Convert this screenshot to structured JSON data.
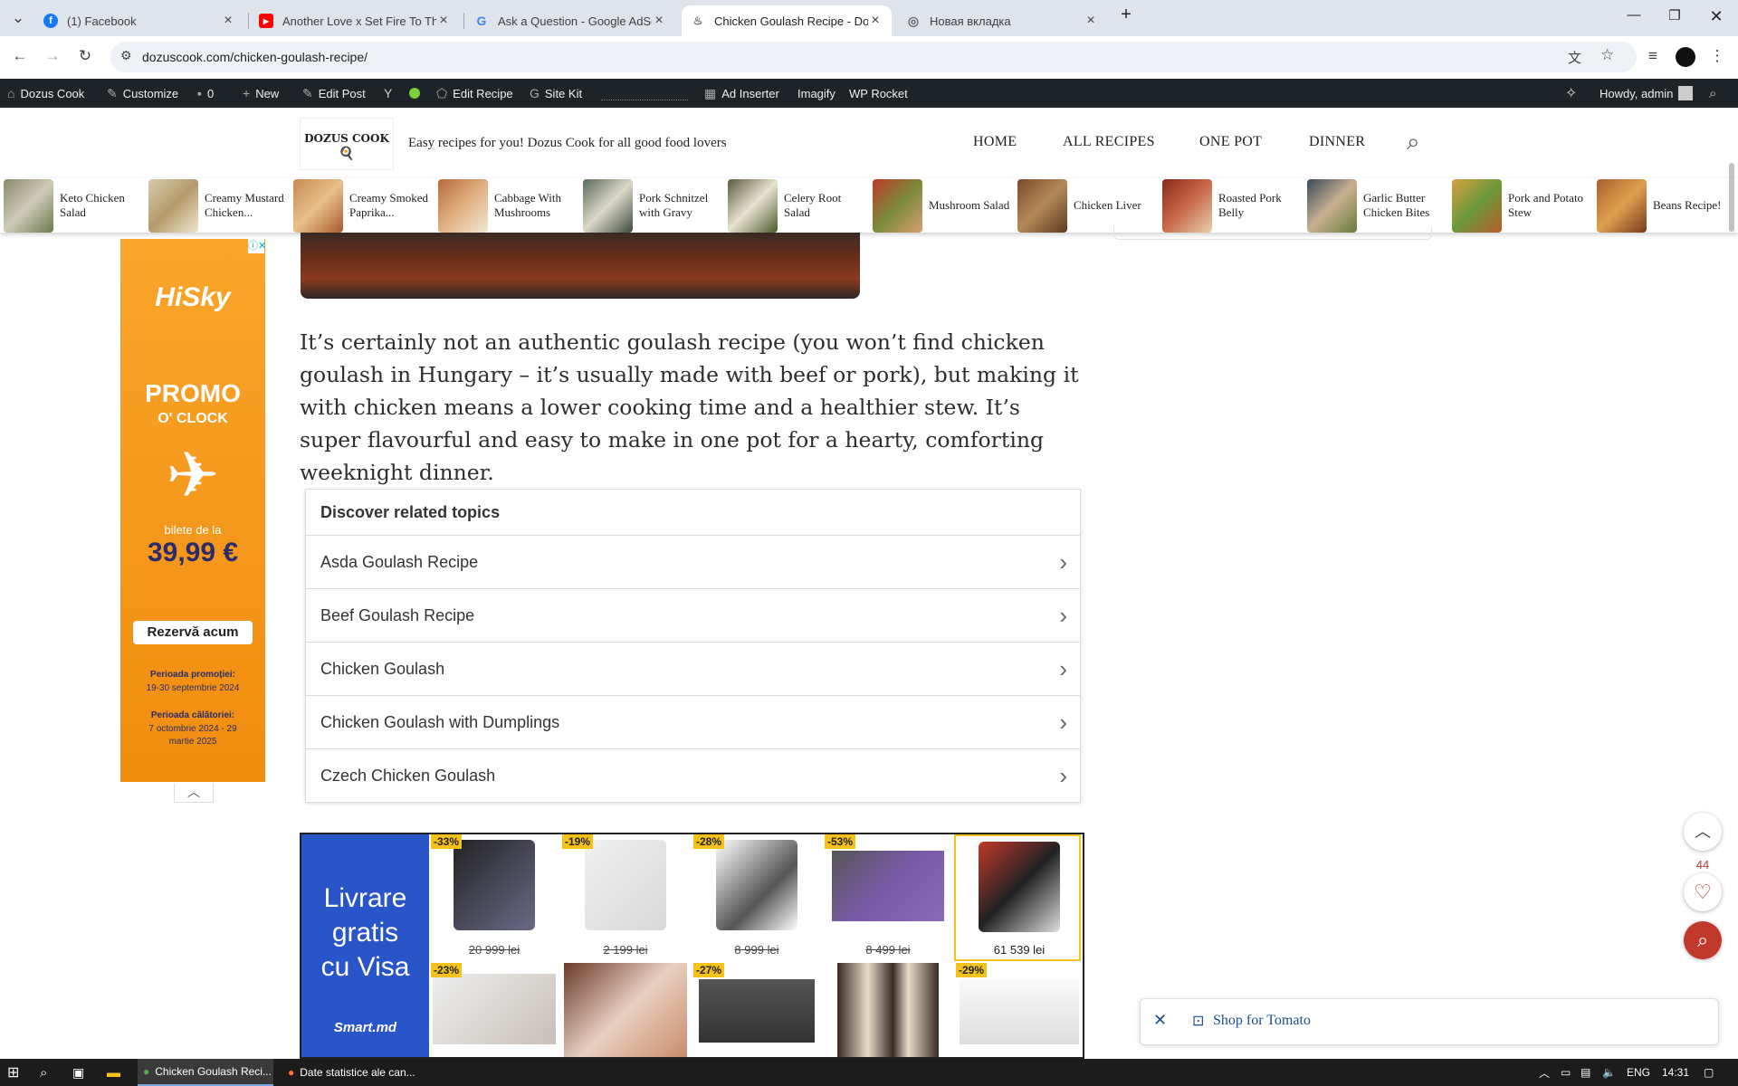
{
  "browser": {
    "tabs": [
      {
        "title": "(1) Facebook",
        "icon": "facebook-icon"
      },
      {
        "title": "Another Love x Set Fire To The R",
        "icon": "youtube-icon"
      },
      {
        "title": "Ask a Question - Google AdSen",
        "icon": "google-icon"
      },
      {
        "title": "Chicken Goulash Recipe - Dozu",
        "icon": "site-icon"
      },
      {
        "title": "Новая вкладка",
        "icon": "chrome-icon"
      }
    ],
    "url": "dozuscook.com/chicken-goulash-recipe/"
  },
  "adminbar": {
    "site": "Dozus Cook",
    "customize": "Customize",
    "comments": "0",
    "new": "New",
    "edit_post": "Edit Post",
    "edit_recipe": "Edit Recipe",
    "site_kit": "Site Kit",
    "ad_inserter": "Ad Inserter",
    "imagify": "Imagify",
    "wp_rocket": "WP Rocket",
    "howdy": "Howdy, admin"
  },
  "site": {
    "logo": "DOZUS COOK",
    "tagline": "Easy recipes for you! Dozus Cook for all good food lovers",
    "menu": [
      "HOME",
      "ALL RECIPES",
      "ONE POT",
      "DINNER"
    ]
  },
  "recipe_strip": [
    "Keto Chicken Salad",
    "Creamy Mustard Chicken...",
    "Creamy Smoked Paprika...",
    "Cabbage With Mushrooms",
    "Pork Schnitzel with Gravy",
    "Celery Root Salad",
    "Mushroom Salad",
    "Chicken Liver",
    "Roasted Pork Belly",
    "Garlic Butter Chicken Bites",
    "Pork and Potato Stew",
    "Beans Recipe!"
  ],
  "article": {
    "paragraph": "It’s certainly not an authentic goulash recipe (you won’t find chicken goulash in Hungary – it’s usually made with beef or pork), but making it with chicken means a lower cooking time and a healthier stew. It’s super flavourful and easy to make in one pot for a hearty, comforting weeknight dinner."
  },
  "related": {
    "title": "Discover related topics",
    "items": [
      "Asda Goulash Recipe",
      "Beef Goulash Recipe",
      "Chicken Goulash",
      "Chicken Goulash with Dumplings",
      "Czech Chicken Goulash"
    ]
  },
  "side_ad": {
    "brand": "HiSky",
    "promo": "PROMO",
    "oclock": "O' CLOCK",
    "bilete": "bilete de la",
    "price": "39,99 €",
    "cta": "Rezervă acum",
    "promo_period_label": "Perioada promoției:",
    "promo_period": "19-30 septembrie 2024",
    "travel_period_label": "Perioada călătoriei:",
    "travel_period": "7 octombrie 2024 - 29 martie 2025"
  },
  "bottom_ad": {
    "headline": [
      "Livrare",
      "gratis",
      "cu Visa"
    ],
    "brand": "Smart.md",
    "products_top": [
      {
        "discount": "-33%",
        "price": "20 999 lei",
        "icon": "phone"
      },
      {
        "discount": "-19%",
        "price": "2 199 lei",
        "icon": "chair"
      },
      {
        "discount": "-28%",
        "price": "8 999 lei",
        "icon": "scooter"
      },
      {
        "discount": "-53%",
        "price": "8 499 lei",
        "icon": "sofa"
      },
      {
        "discount": "",
        "price": "61 539 lei",
        "icon": "motorcycle"
      }
    ],
    "products_bottom": [
      {
        "discount": "-23%",
        "icon": "bedroom"
      },
      {
        "discount": "",
        "icon": "bed"
      },
      {
        "discount": "-27%",
        "icon": "couch"
      },
      {
        "discount": "",
        "icon": "cabinet"
      },
      {
        "discount": "-29%",
        "icon": "daybed"
      }
    ]
  },
  "floating": {
    "likes": "44",
    "shop_label": "Shop for Tomato"
  },
  "taskbar": {
    "apps": [
      "Chicken Goulash Reci...",
      "Date statistice ale can..."
    ],
    "lang": "ENG",
    "time": "14:31"
  }
}
